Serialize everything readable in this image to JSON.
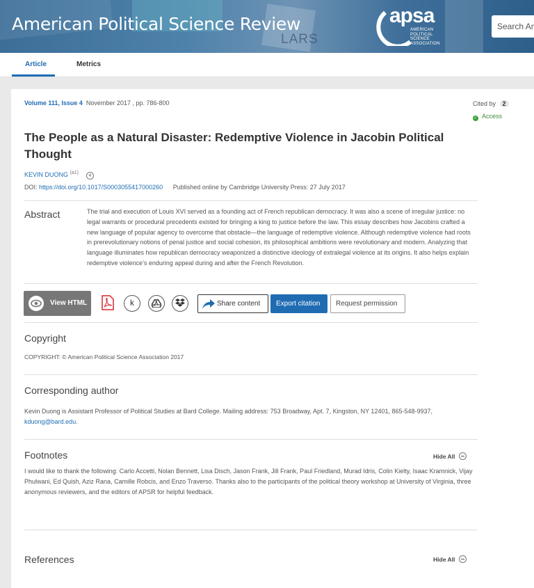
{
  "header": {
    "journal_title": "American Political Science Review",
    "banner_text": "LARS",
    "logo": {
      "word": "apsa",
      "subtitle": "American Political Science Association"
    },
    "search_placeholder": "Search Am"
  },
  "tabs": [
    {
      "label": "Article",
      "active": true
    },
    {
      "label": "Metrics",
      "active": false
    }
  ],
  "article": {
    "volume_issue": "Volume 111, Issue 4",
    "date_pages": "November 2017 , pp. 786-800",
    "cited_by_label": "Cited by",
    "cited_by_count": "2",
    "access_label": "Access",
    "title": "The People as a Natural Disaster: Redemptive Violence in Jacobin Political Thought",
    "author": "KEVIN DUONG",
    "author_affil": "(a1)",
    "doi_label": "DOI:",
    "doi_link": "https://doi.org/10.1017/S0003055417000260",
    "published": "Published online by Cambridge University Press: 27 July 2017"
  },
  "abstract": {
    "heading": "Abstract",
    "text": "The trial and execution of Louis XVI served as a founding act of French republican democracy. It was also a scene of irregular justice: no legal warrants or procedural precedents existed for bringing a king to justice before the law. This essay describes how Jacobins crafted a new language of popular agency to overcome that obstacle—the language of redemptive violence. Although redemptive violence had roots in prerevolutionary notions of penal justice and social cohesion, its philosophical ambitions were revolutionary and modern. Analyzing that language illuminates how republican democracy weaponized a distinctive ideology of extralegal violence at its origins. It also helps explain redemptive violence’s enduring appeal during and after the French Revolution."
  },
  "toolbar": {
    "view_html": "View HTML",
    "kudos_glyph": "k",
    "share": "Share content",
    "export": "Export citation",
    "permission": "Request permission"
  },
  "copyright": {
    "heading": "Copyright",
    "text": "COPYRIGHT: © American Political Science Association 2017"
  },
  "corresponding": {
    "heading": "Corresponding author",
    "text": "Kevin Duong is Assistant Professor of Political Studies at Bard College. Mailing address: 753 Broadway, Apt. 7, Kingston, NY 12401, 865-548-9937,",
    "email": "kduong@bard.edu",
    "after": "."
  },
  "footnotes": {
    "heading": "Footnotes",
    "hide_label": "Hide All",
    "text": "I would like to thank the following: Carlo Accetti, Nolan Bennett, Lisa Disch, Jason Frank, Jill Frank, Paul Friedland, Murad Idris, Colin Kielty, Isaac Kramnick, Vijay Phulwani, Ed Quish, Aziz Rana, Camille Robcis, and Enzo Traverso. Thanks also to the participants of the political theory workshop at University of Virginia, three anonymous reviewers, and the editors of APSR for helpful feedback."
  },
  "references": {
    "heading": "References",
    "hide_label": "Hide All"
  },
  "colors": {
    "link": "#1f6cb3",
    "primary_button": "#1f6cb3",
    "access": "#3ba13b"
  }
}
